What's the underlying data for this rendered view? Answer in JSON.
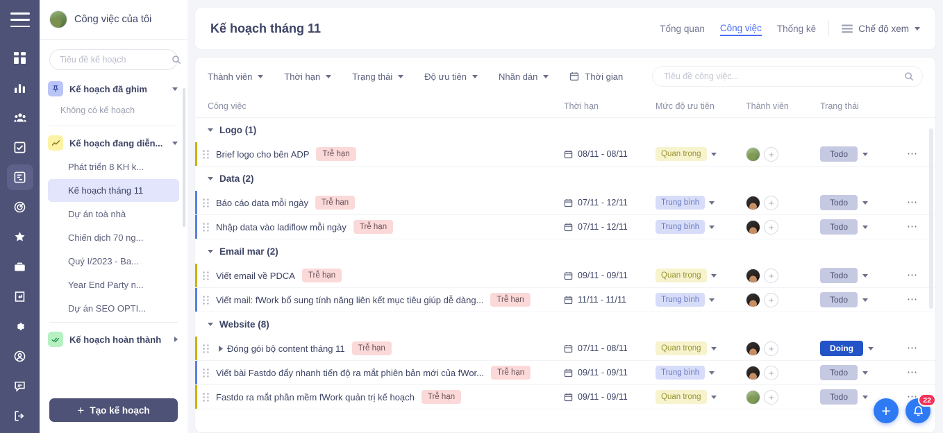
{
  "rail": {
    "menu_icon": "hamburger-menu-icon",
    "items": [
      {
        "name": "dashboard-icon",
        "label": "Dashboard",
        "active": false
      },
      {
        "name": "chart-bar-icon",
        "label": "Báo cáo",
        "active": false
      },
      {
        "name": "team-icon",
        "label": "Nhân sự",
        "active": false
      },
      {
        "name": "checkbox-task-icon",
        "label": "Công việc",
        "active": false
      },
      {
        "name": "plan-board-icon",
        "label": "Kế hoạch",
        "active": true
      },
      {
        "name": "target-icon",
        "label": "Mục tiêu",
        "active": false
      },
      {
        "name": "star-icon",
        "label": "Đánh giá",
        "active": false
      },
      {
        "name": "briefcase-icon",
        "label": "Tài nguyên",
        "active": false
      },
      {
        "name": "document-icon",
        "label": "Tài liệu",
        "active": false
      },
      {
        "name": "gear-icon",
        "label": "Cài đặt",
        "active": false
      },
      {
        "name": "user-circle-icon",
        "label": "Tài khoản",
        "active": false
      },
      {
        "name": "feedback-icon",
        "label": "Phản hồi",
        "active": false
      },
      {
        "name": "logout-icon",
        "label": "Đăng xuất",
        "active": false
      }
    ]
  },
  "sidebar": {
    "workspace_title": "Công việc của tôi",
    "avatar": "user-avatar",
    "search": {
      "value": "",
      "placeholder": "Tiêu đề kế hoạch",
      "icon": "search-icon"
    },
    "groups": [
      {
        "id": "pinned",
        "label": "Kế hoạch đã ghim",
        "icon": "pin-icon",
        "badge_color": "#b9c4f7",
        "expanded": true,
        "empty_text": "Không có kế hoạch",
        "items": []
      },
      {
        "id": "ongoing",
        "label": "Kế hoạch đang diễn...",
        "icon": "trend-up-icon",
        "badge_color": "#fdf3a6",
        "expanded": true,
        "empty_text": "",
        "items": [
          {
            "label": "Phát triển 8 KH k...",
            "selected": false
          },
          {
            "label": "Kế hoạch tháng 11",
            "selected": true
          },
          {
            "label": "Dự án toà nhà",
            "selected": false
          },
          {
            "label": "Chiến dịch 70 ng...",
            "selected": false
          },
          {
            "label": "Quý I/2023 - Ba...",
            "selected": false
          },
          {
            "label": "Year End Party n...",
            "selected": false
          },
          {
            "label": "Dự án SEO OPTI...",
            "selected": false
          }
        ]
      },
      {
        "id": "completed",
        "label": "Kế hoạch hoàn thành",
        "icon": "double-check-icon",
        "badge_color": "#b7f0c3",
        "expanded": false,
        "empty_text": "",
        "items": []
      }
    ],
    "create_button": {
      "label": "Tạo kế hoạch",
      "icon": "plus-icon"
    }
  },
  "header": {
    "title": "Kế hoạch tháng 11",
    "tabs": [
      {
        "label": "Tổng quan",
        "active": false
      },
      {
        "label": "Công việc",
        "active": true
      },
      {
        "label": "Thống kê",
        "active": false
      }
    ],
    "view_mode": {
      "label": "Chế độ xem",
      "icon": "rows-view-icon"
    }
  },
  "toolbar": {
    "filters": [
      {
        "label": "Thành viên",
        "has_caret": true,
        "icon": ""
      },
      {
        "label": "Thời hạn",
        "has_caret": true,
        "icon": ""
      },
      {
        "label": "Trạng thái",
        "has_caret": true,
        "icon": ""
      },
      {
        "label": "Độ ưu tiên",
        "has_caret": true,
        "icon": ""
      },
      {
        "label": "Nhãn dán",
        "has_caret": true,
        "icon": ""
      },
      {
        "label": "Thời gian",
        "has_caret": false,
        "icon": "calendar-icon"
      }
    ],
    "search": {
      "value": "",
      "placeholder": "Tiêu đề công việc...",
      "icon": "search-icon"
    }
  },
  "table": {
    "columns": {
      "task": "Công việc",
      "due": "Thời hạn",
      "priority": "Mức độ ưu tiên",
      "member": "Thành viên",
      "status": "Trạng thái"
    },
    "groups": [
      {
        "title": "Logo (1)",
        "expanded": true,
        "rows": [
          {
            "name": "Brief logo cho bên ADP",
            "bar_color": "#c8b216",
            "late_label": "Trễ hạn",
            "due": "08/11 - 08/11",
            "priority": "Quan trọng",
            "priority_kind": "high",
            "avatar": "a1",
            "status": "Todo",
            "status_kind": "todo",
            "has_expander": false
          }
        ]
      },
      {
        "title": "Data (2)",
        "expanded": true,
        "rows": [
          {
            "name": "Báo cáo data mỗi ngày",
            "bar_color": "#5b7fe0",
            "late_label": "Trễ hạn",
            "due": "07/11 - 12/11",
            "priority": "Trung bình",
            "priority_kind": "mid",
            "avatar": "a2",
            "status": "Todo",
            "status_kind": "todo",
            "has_expander": false
          },
          {
            "name": "Nhập data vào ladiflow mỗi ngày",
            "bar_color": "#5b7fe0",
            "late_label": "Trễ hạn",
            "due": "07/11 - 12/11",
            "priority": "Trung bình",
            "priority_kind": "mid",
            "avatar": "a2",
            "status": "Todo",
            "status_kind": "todo",
            "has_expander": false
          }
        ]
      },
      {
        "title": "Email mar (2)",
        "expanded": true,
        "rows": [
          {
            "name": "Viết email về PDCA",
            "bar_color": "#c8b216",
            "late_label": "Trễ hạn",
            "due": "09/11 - 09/11",
            "priority": "Quan trọng",
            "priority_kind": "high",
            "avatar": "a2",
            "status": "Todo",
            "status_kind": "todo",
            "has_expander": false
          },
          {
            "name": "Viết mail: fWork bổ sung tính năng liên kết mục tiêu giúp dễ dàng...",
            "bar_color": "#5b7fe0",
            "late_label": "Trễ hạn",
            "due": "11/11 - 11/11",
            "priority": "Trung bình",
            "priority_kind": "mid",
            "avatar": "a2",
            "status": "Todo",
            "status_kind": "todo",
            "has_expander": false
          }
        ]
      },
      {
        "title": "Website (8)",
        "expanded": true,
        "rows": [
          {
            "name": "Đóng gói bộ content tháng 11",
            "bar_color": "#c8b216",
            "late_label": "Trễ hạn",
            "due": "07/11 - 08/11",
            "priority": "Quan trọng",
            "priority_kind": "high",
            "avatar": "a2",
            "status": "Doing",
            "status_kind": "doing",
            "has_expander": true
          },
          {
            "name": "Viết bài Fastdo đẩy nhanh tiến độ ra mắt phiên bản mới của fWor...",
            "bar_color": "#5b7fe0",
            "late_label": "Trễ hạn",
            "due": "09/11 - 09/11",
            "priority": "Trung bình",
            "priority_kind": "mid",
            "avatar": "a2",
            "status": "Todo",
            "status_kind": "todo",
            "has_expander": false
          },
          {
            "name": "Fastdo ra mắt phần mềm fWork quản trị kế hoạch",
            "bar_color": "#c8b216",
            "late_label": "Trễ hạn",
            "due": "09/11 - 09/11",
            "priority": "Quan trọng",
            "priority_kind": "high",
            "avatar": "a1",
            "status": "Todo",
            "status_kind": "todo",
            "has_expander": false
          }
        ]
      }
    ]
  },
  "fab": {
    "add": {
      "icon": "plus-icon",
      "label": "+"
    },
    "notification": {
      "icon": "bell-icon",
      "count": "22"
    }
  },
  "colors": {
    "accent": "#4a6cf7",
    "rail_bg": "#4e5276",
    "fab_blue": "#2e7af5",
    "badge_red": "#f3325a",
    "doing_blue": "#2354c7"
  }
}
